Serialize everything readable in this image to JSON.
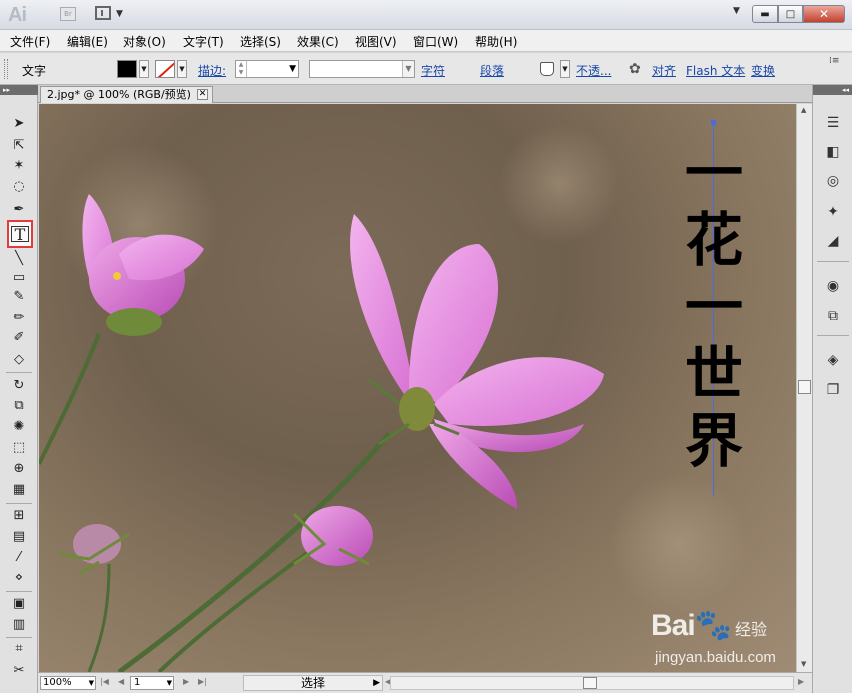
{
  "app": {
    "logo": "Ai",
    "bridge_label": "Br"
  },
  "menubar": {
    "items": [
      "文件(F)",
      "编辑(E)",
      "对象(O)",
      "文字(T)",
      "选择(S)",
      "效果(C)",
      "视图(V)",
      "窗口(W)",
      "帮助(H)"
    ]
  },
  "control": {
    "tool_label": "文字",
    "stroke_label": "描边:",
    "character": "字符",
    "paragraph": "段落",
    "opacity": "不透...",
    "align": "对齐",
    "flash_text": "Flash 文本",
    "transform": "变换"
  },
  "document": {
    "tab_title": "2.jpg* @ 100% (RGB/预览)",
    "text_chars": [
      "一",
      "花",
      "一",
      "世",
      "界"
    ]
  },
  "status": {
    "zoom": "100%",
    "page": "1",
    "tool": "选择"
  },
  "watermark": {
    "brand": "Bai",
    "brand_cn": "经验",
    "url": "jingyan.baidu.com"
  },
  "colors": {
    "selected_tool_border": "#e23b3b",
    "link": "#1947a8",
    "guide": "#4a6be0"
  }
}
